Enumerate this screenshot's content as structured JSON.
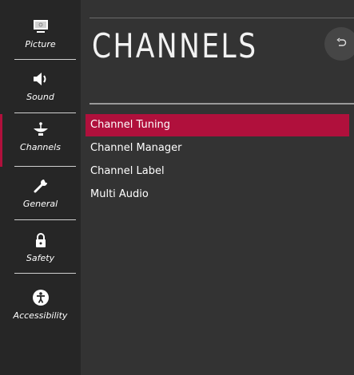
{
  "sidebar": {
    "items": [
      {
        "label": "Picture",
        "icon": "picture-icon"
      },
      {
        "label": "Sound",
        "icon": "speaker-icon"
      },
      {
        "label": "Channels",
        "icon": "satellite-dish-icon",
        "active": true
      },
      {
        "label": "General",
        "icon": "wrench-icon"
      },
      {
        "label": "Safety",
        "icon": "lock-icon"
      },
      {
        "label": "Accessibility",
        "icon": "accessibility-icon"
      }
    ]
  },
  "main": {
    "title": "CHANNELS",
    "back_icon": "back-icon",
    "menu": [
      {
        "label": "Channel Tuning",
        "selected": true
      },
      {
        "label": "Channel Manager"
      },
      {
        "label": "Channel Label"
      },
      {
        "label": "Multi Audio"
      }
    ]
  },
  "colors": {
    "accent": "#b0103c",
    "sidebar_bg": "#262626",
    "main_bg": "#333333"
  }
}
